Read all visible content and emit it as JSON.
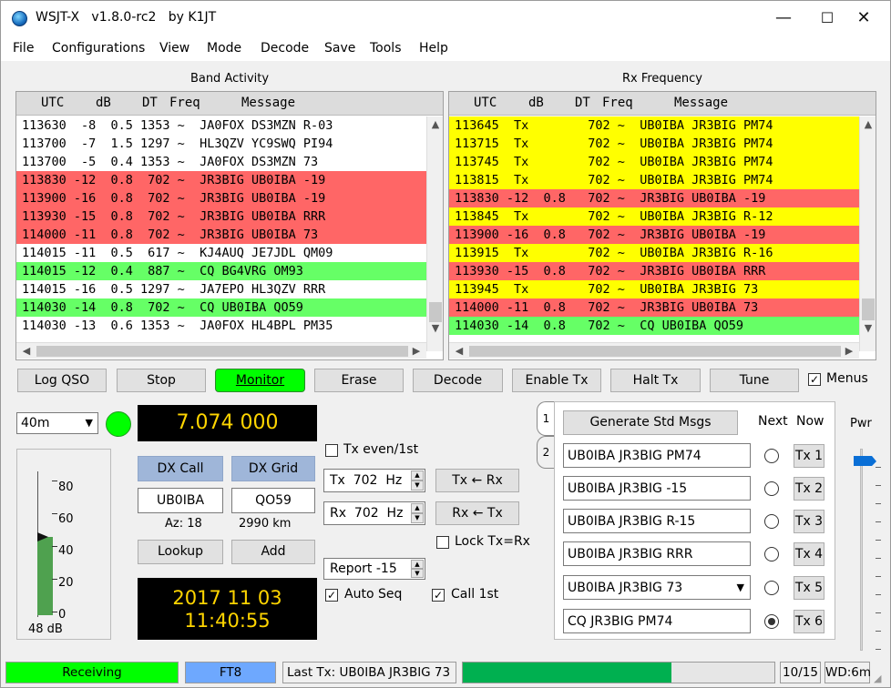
{
  "window": {
    "title": "WSJT-X   v1.8.0-rc2   by K1JT",
    "controls": [
      "—",
      "☐",
      "✕"
    ]
  },
  "menu": [
    "File",
    "Configurations",
    "View",
    "Mode",
    "Decode",
    "Save",
    "Tools",
    "Help"
  ],
  "band_activity": {
    "title": "Band Activity",
    "headers": [
      "UTC",
      "dB",
      "DT",
      "Freq",
      "Message"
    ],
    "rows": [
      {
        "text": "113630  -8  0.5 1353 ~  JA0FOX DS3MZN R-03",
        "color": "#ffffff"
      },
      {
        "text": "113700  -7  1.5 1297 ~  HL3QZV YC9SWQ PI94",
        "color": "#ffffff"
      },
      {
        "text": "113700  -5  0.4 1353 ~  JA0FOX DS3MZN 73",
        "color": "#ffffff"
      },
      {
        "text": "113830 -12  0.8  702 ~  JR3BIG UB0IBA -19",
        "color": "#ff6666"
      },
      {
        "text": "113900 -16  0.8  702 ~  JR3BIG UB0IBA -19",
        "color": "#ff6666"
      },
      {
        "text": "113930 -15  0.8  702 ~  JR3BIG UB0IBA RRR",
        "color": "#ff6666"
      },
      {
        "text": "114000 -11  0.8  702 ~  JR3BIG UB0IBA 73",
        "color": "#ff6666"
      },
      {
        "text": "114015 -11  0.5  617 ~  KJ4AUQ JE7JDL QM09",
        "color": "#ffffff"
      },
      {
        "text": "114015 -12  0.4  887 ~  CQ BG4VRG OM93",
        "color": "#66ff66"
      },
      {
        "text": "114015 -16  0.5 1297 ~  JA7EPO HL3QZV RRR",
        "color": "#ffffff"
      },
      {
        "text": "114030 -14  0.8  702 ~  CQ UB0IBA QO59",
        "color": "#66ff66"
      },
      {
        "text": "114030 -13  0.6 1353 ~  JA0FOX HL4BPL PM35",
        "color": "#ffffff"
      }
    ]
  },
  "rx_frequency": {
    "title": "Rx Frequency",
    "headers": [
      "UTC",
      "dB",
      "DT",
      "Freq",
      "Message"
    ],
    "rows": [
      {
        "text": "113645  Tx        702 ~  UB0IBA JR3BIG PM74",
        "color": "#ffff00"
      },
      {
        "text": "113715  Tx        702 ~  UB0IBA JR3BIG PM74",
        "color": "#ffff00"
      },
      {
        "text": "113745  Tx        702 ~  UB0IBA JR3BIG PM74",
        "color": "#ffff00"
      },
      {
        "text": "113815  Tx        702 ~  UB0IBA JR3BIG PM74",
        "color": "#ffff00"
      },
      {
        "text": "113830 -12  0.8   702 ~  JR3BIG UB0IBA -19",
        "color": "#ff6666"
      },
      {
        "text": "113845  Tx        702 ~  UB0IBA JR3BIG R-12",
        "color": "#ffff00"
      },
      {
        "text": "113900 -16  0.8   702 ~  JR3BIG UB0IBA -19",
        "color": "#ff6666"
      },
      {
        "text": "113915  Tx        702 ~  UB0IBA JR3BIG R-16",
        "color": "#ffff00"
      },
      {
        "text": "113930 -15  0.8   702 ~  JR3BIG UB0IBA RRR",
        "color": "#ff6666"
      },
      {
        "text": "113945  Tx        702 ~  UB0IBA JR3BIG 73",
        "color": "#ffff00"
      },
      {
        "text": "114000 -11  0.8   702 ~  JR3BIG UB0IBA 73",
        "color": "#ff6666"
      },
      {
        "text": "114030 -14  0.8   702 ~  CQ UB0IBA QO59",
        "color": "#66ff66"
      }
    ]
  },
  "buttons": {
    "log_qso": "Log QSO",
    "stop": "Stop",
    "monitor": "Monitor",
    "erase": "Erase",
    "decode": "Decode",
    "enable_tx": "Enable Tx",
    "halt_tx": "Halt Tx",
    "tune": "Tune",
    "menus": "Menus",
    "lookup": "Lookup",
    "add": "Add",
    "tx_from_rx": "Tx ← Rx",
    "rx_from_tx": "Rx ← Tx",
    "generate": "Generate Std Msgs"
  },
  "band": "40m",
  "frequency": "7.074 000",
  "dx": {
    "call_label": "DX Call",
    "grid_label": "DX Grid",
    "call": "UB0IBA",
    "grid": "QO59",
    "az": "Az: 18",
    "dist": "2990 km"
  },
  "datetime": {
    "date": "2017 11 03",
    "time": "11:40:55"
  },
  "meter": {
    "ticks": [
      "80",
      "60",
      "40",
      "20",
      "0"
    ],
    "level_db": 48,
    "label": "48 dB"
  },
  "controls": {
    "tx_even": "Tx even/1st",
    "tx_freq": "Tx  702  Hz",
    "rx_freq": "Rx  702  Hz",
    "lock": "Lock Tx=Rx",
    "report": "Report -15",
    "auto_seq": "Auto Seq",
    "call_1st": "Call 1st"
  },
  "tabs": [
    "1",
    "2"
  ],
  "messages": {
    "next_label": "Next",
    "now_label": "Now",
    "pwr_label": "Pwr",
    "items": [
      {
        "text": "UB0IBA JR3BIG PM74",
        "tx": "Tx 1"
      },
      {
        "text": "UB0IBA JR3BIG -15",
        "tx": "Tx 2"
      },
      {
        "text": "UB0IBA JR3BIG R-15",
        "tx": "Tx 3"
      },
      {
        "text": "UB0IBA JR3BIG RRR",
        "tx": "Tx 4"
      },
      {
        "text": "UB0IBA JR3BIG 73",
        "tx": "Tx 5"
      },
      {
        "text": "CQ JR3BIG PM74",
        "tx": "Tx 6"
      }
    ]
  },
  "statusbar": {
    "state": "Receiving",
    "mode": "FT8",
    "last_tx": "Last Tx: UB0IBA JR3BIG 73",
    "progress": 0.67,
    "count": "10/15",
    "wd": "WD:6m"
  },
  "colors": {
    "monitor_on": "#00ff00",
    "receiving": "#00ff00",
    "mode_bg": "#6ea8fe",
    "progress": "#00b050"
  }
}
